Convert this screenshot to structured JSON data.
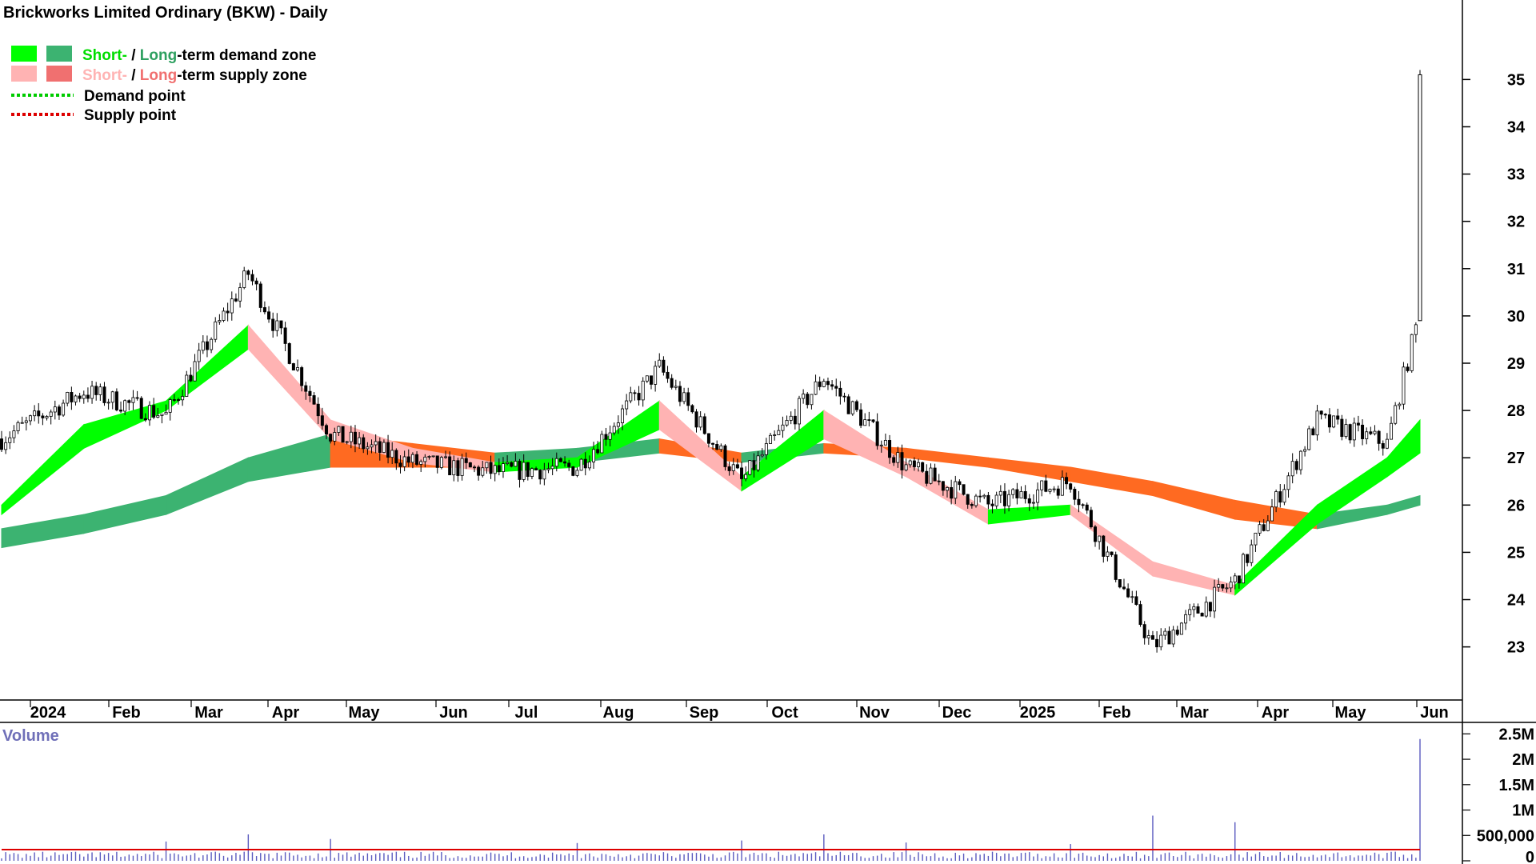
{
  "chart_data": {
    "type": "candlestick",
    "title": "Brickworks Limited Ordinary (BKW) - Daily",
    "legend": [
      {
        "short_label": "Short-",
        "separator": " / ",
        "long_label": "Long",
        "suffix": "-term demand zone",
        "short_color": "#00ff00",
        "long_color": "#3cb371"
      },
      {
        "short_label": "Short-",
        "separator": " / ",
        "long_label": "Long",
        "suffix": "-term supply zone",
        "short_color": "#ffb3b3",
        "long_color": "#f07070"
      },
      {
        "label": "Demand point",
        "color": "#00cc00"
      },
      {
        "label": "Supply point",
        "color": "#dd0000"
      }
    ],
    "price_axis": {
      "ylim": [
        22.3,
        35.7
      ],
      "ticks": [
        "23",
        "24",
        "25",
        "26",
        "27",
        "28",
        "29",
        "30",
        "31",
        "32",
        "33",
        "34",
        "35"
      ]
    },
    "time_axis": {
      "months": [
        "2024",
        "Feb",
        "Mar",
        "Apr",
        "May",
        "Jun",
        "Jul",
        "Aug",
        "Sep",
        "Oct",
        "Nov",
        "Dec",
        "2025",
        "Feb",
        "Mar",
        "Apr",
        "May",
        "Jun"
      ]
    },
    "price_trend": {
      "x": [
        0,
        20,
        40,
        60,
        80,
        100,
        120,
        140,
        160,
        180,
        200,
        220,
        240,
        260,
        280,
        300,
        320,
        337,
        345
      ],
      "close": [
        27.4,
        28.4,
        27.9,
        30.9,
        27.5,
        26.9,
        26.7,
        26.8,
        28.9,
        26.5,
        28.7,
        26.8,
        26.0,
        26.5,
        23.0,
        24.4,
        27.8,
        27.3,
        30.1
      ]
    },
    "short_term_zone": {
      "x": [
        0,
        20,
        40,
        60,
        80,
        100,
        120,
        140,
        160,
        180,
        200,
        220,
        240,
        260,
        280,
        300,
        320,
        337,
        345
      ],
      "upper": [
        26.0,
        27.7,
        28.2,
        29.8,
        27.8,
        27.2,
        26.9,
        27.0,
        28.2,
        26.6,
        28.0,
        26.9,
        25.9,
        26.0,
        24.8,
        24.3,
        26.0,
        27.0,
        27.8
      ],
      "lower": [
        25.8,
        27.2,
        28.0,
        29.3,
        27.4,
        26.9,
        26.7,
        26.8,
        27.6,
        26.3,
        27.4,
        26.6,
        25.6,
        25.8,
        24.5,
        24.1,
        25.6,
        26.6,
        27.1
      ]
    },
    "long_term_zone": {
      "x": [
        0,
        20,
        40,
        60,
        80,
        100,
        120,
        140,
        160,
        180,
        200,
        220,
        240,
        260,
        280,
        300,
        320,
        337,
        345
      ],
      "upper": [
        25.5,
        25.8,
        26.2,
        27.0,
        27.5,
        27.3,
        27.1,
        27.2,
        27.4,
        27.1,
        27.3,
        27.2,
        27.0,
        26.8,
        26.5,
        26.1,
        25.8,
        26.0,
        26.2
      ],
      "lower": [
        25.1,
        25.4,
        25.8,
        26.5,
        26.8,
        26.8,
        26.8,
        26.9,
        27.1,
        26.9,
        27.1,
        27.0,
        26.8,
        26.5,
        26.2,
        25.7,
        25.5,
        25.8,
        26.0
      ]
    },
    "final_candle": {
      "open": 29.9,
      "high": 35.2,
      "low": 29.9,
      "close": 35.1
    },
    "volume": {
      "label": "Volume",
      "ylim": [
        0,
        2600000
      ],
      "ticks": [
        "2.5M",
        "2M",
        "1.5M",
        "1M",
        "500,000",
        "0"
      ],
      "typical": 120000,
      "average_line": 220000,
      "spikes": [
        {
          "x": 40,
          "value": 380000
        },
        {
          "x": 60,
          "value": 520000
        },
        {
          "x": 80,
          "value": 430000
        },
        {
          "x": 140,
          "value": 350000
        },
        {
          "x": 180,
          "value": 400000
        },
        {
          "x": 200,
          "value": 520000
        },
        {
          "x": 220,
          "value": 360000
        },
        {
          "x": 260,
          "value": 330000
        },
        {
          "x": 280,
          "value": 890000
        },
        {
          "x": 300,
          "value": 760000
        },
        {
          "x": 345,
          "value": 2400000
        }
      ],
      "colors": {
        "bars": "#5b5bbf",
        "average": "#dd0000"
      }
    },
    "colors": {
      "short_demand": "#00ff00",
      "long_demand": "#3cb371",
      "short_supply": "#ffb3b3",
      "long_supply": "#f07070",
      "transition": "#ff6a21",
      "candle": "#000000"
    },
    "grid": false
  }
}
